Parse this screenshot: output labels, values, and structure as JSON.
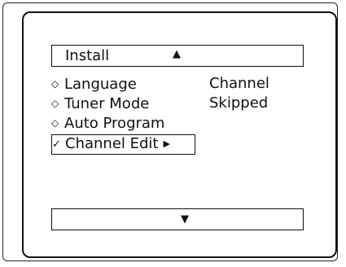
{
  "header": {
    "title": "Install",
    "up_arrow": "▲"
  },
  "menu": {
    "items": [
      {
        "bullet": "◇",
        "label": "Language"
      },
      {
        "bullet": "◇",
        "label": "Tuner Mode"
      },
      {
        "bullet": "◇",
        "label": "Auto Program"
      },
      {
        "bullet": "✓",
        "label": "Channel Edit",
        "arrow": "▶"
      }
    ]
  },
  "status": {
    "line1": "Channel",
    "line2": "Skipped"
  },
  "footer": {
    "down_arrow": "▼"
  }
}
